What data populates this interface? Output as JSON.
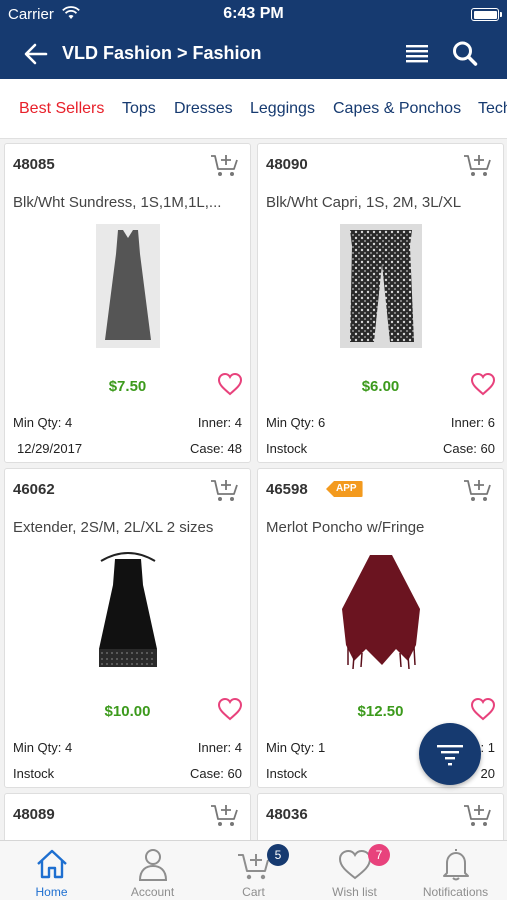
{
  "status": {
    "carrier": "Carrier",
    "time": "6:43 PM"
  },
  "nav": {
    "title": "VLD Fashion > Fashion"
  },
  "categories": [
    "Best Sellers",
    "Tops",
    "Dresses",
    "Leggings",
    "Capes & Ponchos",
    "Tech"
  ],
  "products": [
    {
      "id": "48085",
      "name": "Blk/Wht Sundress, 1S,1M,1L,...",
      "price": "$7.50",
      "min_qty": "Min Qty: 4",
      "inner": "Inner: 4",
      "stock": "12/29/2017",
      "case": "Case: 48",
      "image": "dress-gray"
    },
    {
      "id": "48090",
      "name": "Blk/Wht Capri, 1S, 2M, 3L/XL",
      "price": "$6.00",
      "min_qty": "Min Qty: 6",
      "inner": "Inner: 6",
      "stock": "Instock",
      "case": "Case: 60",
      "image": "capri-pattern"
    },
    {
      "id": "46062",
      "name": "Extender, 2S/M, 2L/XL 2 sizes",
      "price": "$10.00",
      "min_qty": "Min Qty: 4",
      "inner": "Inner: 4",
      "stock": "Instock",
      "case": "Case: 60",
      "image": "dress-black"
    },
    {
      "id": "46598",
      "badge": "APP",
      "name": "Merlot Poncho w/Fringe",
      "price": "$12.50",
      "min_qty": "Min Qty: 1",
      "inner": ": 1",
      "stock": "Instock",
      "case": "20",
      "image": "poncho-merlot"
    },
    {
      "id": "48089",
      "name": ""
    },
    {
      "id": "48036",
      "name": ""
    }
  ],
  "tabs": [
    {
      "label": "Home",
      "icon": "home-icon",
      "active": true
    },
    {
      "label": "Account",
      "icon": "person-icon"
    },
    {
      "label": "Cart",
      "icon": "cart-icon",
      "badge": "5"
    },
    {
      "label": "Wish list",
      "icon": "heart-icon",
      "badge": "7"
    },
    {
      "label": "Notifications",
      "icon": "bell-icon"
    }
  ],
  "colors": {
    "brand": "#163a70",
    "active_category": "#e8202a",
    "price": "#3c9a1c",
    "heart": "#e8427c",
    "tab_active": "#1e6fd0",
    "cart_badge": "#163a70",
    "wish_badge": "#e8427c",
    "app_badge": "#f39a1e"
  }
}
